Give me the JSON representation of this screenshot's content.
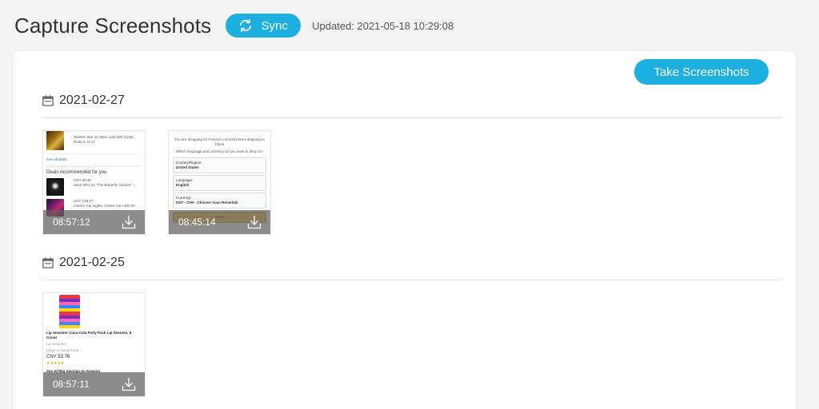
{
  "header": {
    "title": "Capture Screenshots",
    "sync_label": "Sync",
    "updated_text": "Updated: 2021-05-18 10:29:08"
  },
  "card": {
    "take_button_label": "Take Screenshots"
  },
  "groups": [
    {
      "date": "2021-02-27",
      "shots": [
        {
          "time": "08:57:12",
          "preview": {
            "line1": "Twinkle Star 12 Stars 138 LED Curtai...",
            "line2": "Ends in 11:17",
            "see_all": "See all deals",
            "section": "Deals recommended for you",
            "deal1_price": "CNY 56.45",
            "deal1_text": "Save 50% on \"The Butterfly Garden\" -...",
            "deal2_price": "CNY 139.07",
            "deal2_text": "Interior Car Lights, Govee Car LED Str..."
          }
        },
        {
          "time": "08:45:14",
          "preview": {
            "line1": "You are shopping for Amazon.com(US) items shipping to",
            "line2": "China",
            "line3": "Which language and currency do you want to shop in?",
            "country_label": "Country/Region:",
            "country_value": "United States",
            "language_label": "Language:",
            "language_value": "English",
            "currency_label": "Currency:",
            "currency_value": "CNY - CN¥ - Chinese Yuan Renminbi",
            "done": "Done"
          }
        }
      ]
    },
    {
      "date": "2021-02-25",
      "shots": [
        {
          "time": "08:57:11",
          "preview": {
            "product": "Lip Smacker Coca-Cola Party Pack Lip Glosses, 8 Count",
            "brand": "Lip Smacker",
            "ships": "Ships to Hong Kong",
            "price": "CNY 52.76",
            "see_all": "See All Big Savings on Amazon"
          }
        }
      ]
    }
  ],
  "icons": {
    "sync": "sync-icon",
    "calendar": "calendar-icon",
    "download": "download-icon"
  },
  "colors": {
    "accent": "#1cb0e0",
    "background": "#f3f3f3",
    "card": "#ffffff",
    "overlay": "#5f5f5f"
  }
}
